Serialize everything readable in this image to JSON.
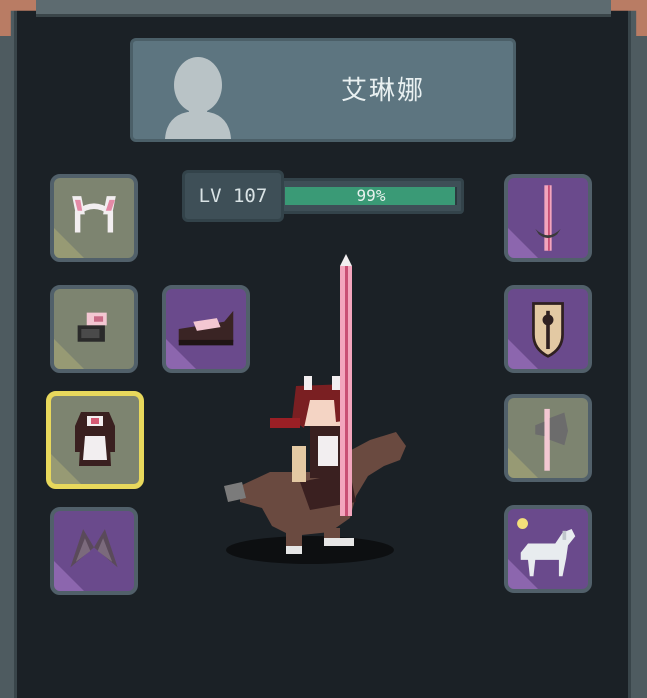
{
  "character": {
    "name": "艾琳娜",
    "level_label": "LV 107",
    "xp_text": "99%",
    "xp_fraction": 0.99
  },
  "left_slots": [
    {
      "name": "headgear-slot",
      "icon": "bunny-ears-headband-icon",
      "rarity": "olive"
    },
    {
      "name": "gloves-slot",
      "icon": "gauntlet-icon",
      "rarity": "olive"
    },
    {
      "name": "armor-slot",
      "icon": "maid-dress-icon",
      "rarity": "olive",
      "selected": true
    },
    {
      "name": "cape-slot",
      "icon": "wings-icon",
      "rarity": "purple"
    }
  ],
  "extra_slots": [
    {
      "name": "boots-slot",
      "icon": "boots-icon",
      "rarity": "purple"
    }
  ],
  "right_slots": [
    {
      "name": "weapon-slot",
      "icon": "lance-icon",
      "rarity": "purple"
    },
    {
      "name": "shield-slot",
      "icon": "shield-icon",
      "rarity": "purple"
    },
    {
      "name": "secondary-weapon-slot",
      "icon": "axe-icon",
      "rarity": "olive"
    },
    {
      "name": "mount-slot",
      "icon": "white-horse-icon",
      "rarity": "purple"
    }
  ],
  "colors": {
    "xp_fill": "#3a9a76",
    "selected_border": "#e8d85c",
    "olive_slot": "#7d8470",
    "purple_slot": "#6a4a8c"
  }
}
